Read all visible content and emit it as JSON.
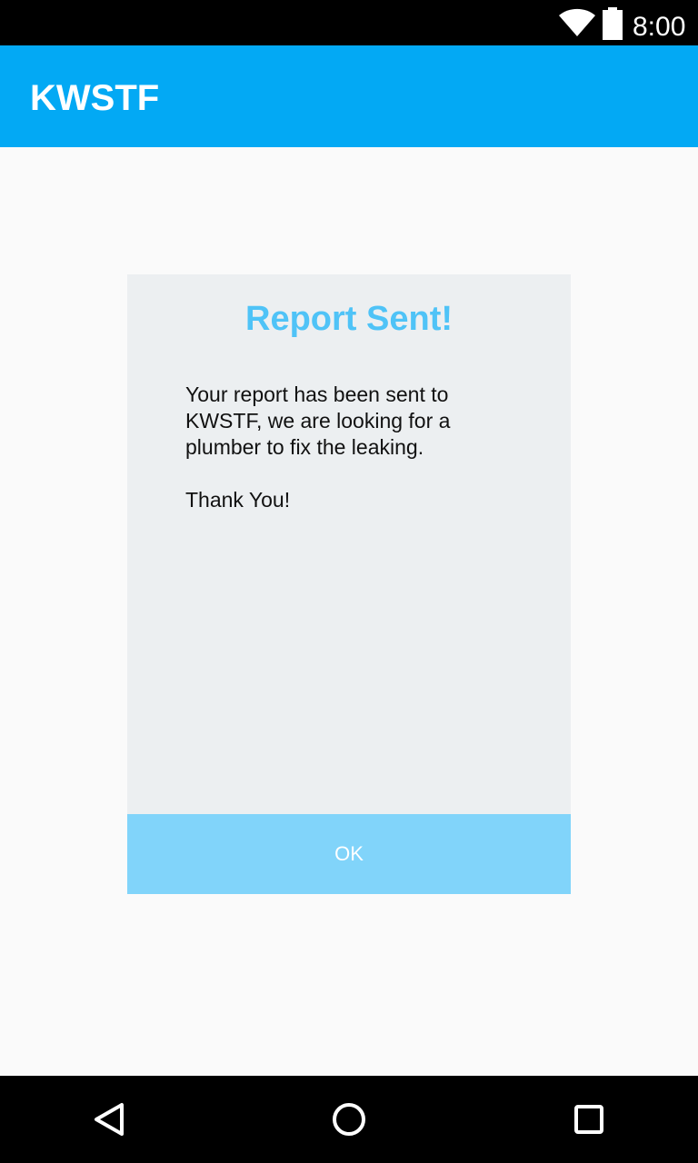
{
  "status_bar": {
    "time": "8:00",
    "icons": [
      "wifi-icon",
      "battery-icon"
    ]
  },
  "app_bar": {
    "title": "KWSTF"
  },
  "dialog": {
    "title": "Report Sent!",
    "message_lines": [
      "Your report has been sent to",
      "KWSTF, we are looking for a",
      "plumber to fix the leaking."
    ],
    "thanks": "Thank You!",
    "ok_label": "OK"
  },
  "nav_bar": {
    "icons": [
      "back-icon",
      "home-icon",
      "recents-icon"
    ]
  },
  "colors": {
    "primary": "#03a9f4",
    "dialog_title": "#4fc3f7",
    "ok_button": "#81d4fa",
    "dialog_background": "#eceff1"
  }
}
